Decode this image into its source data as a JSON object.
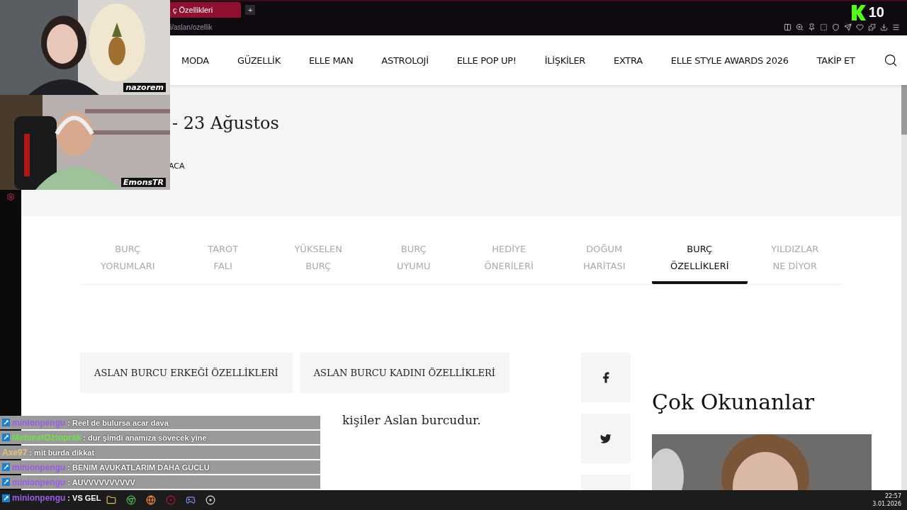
{
  "browser": {
    "tab_title": "ç Özellikleri",
    "new_tab": "+",
    "url": "i/aslan/ozellik"
  },
  "stream_overlay": {
    "viewers": "10"
  },
  "webcams": [
    {
      "kind": "picture",
      "label": "nazorem"
    },
    {
      "kind": "picture",
      "label": "EmonsTR"
    }
  ],
  "nav": {
    "items": [
      "MODA",
      "GÜZELLİK",
      "ELLE MAN",
      "ASTROLOJİ",
      "ELLE POP UP!",
      "İLİŞKİLER",
      "EXTRA",
      "ELLE STYLE AWARDS 2026",
      "TAKİP ET"
    ]
  },
  "header": {
    "date_range": "- 23 Ağustos",
    "element_partial": "ACA"
  },
  "tabs": [
    {
      "lines": [
        "BURÇ",
        "YORUMLARI"
      ],
      "selected": false
    },
    {
      "lines": [
        "TAROT",
        "FALI"
      ],
      "selected": false
    },
    {
      "lines": [
        "YÜKSELEN",
        "BURÇ"
      ],
      "selected": false
    },
    {
      "lines": [
        "BURÇ",
        "UYUMU"
      ],
      "selected": false
    },
    {
      "lines": [
        "HEDİYE",
        "ÖNERİLERİ"
      ],
      "selected": false
    },
    {
      "lines": [
        "DOĞUM",
        "HARİTASI"
      ],
      "selected": false
    },
    {
      "lines": [
        "BURÇ",
        "ÖZELLİKLERİ"
      ],
      "selected": true
    },
    {
      "lines": [
        "YILDIZLAR",
        "NE DİYOR"
      ],
      "selected": false
    }
  ],
  "gender_buttons": [
    "ASLAN BURCU ERKEĞİ ÖZELLİKLERİ",
    "ASLAN BURCU KADINI ÖZELLİKLERİ"
  ],
  "intro": "kişiler Aslan burcudur.",
  "sidebar": {
    "title": "Çok Okunanlar"
  },
  "chat": [
    {
      "user": "minionpengu",
      "color": "#9b5de5",
      "badge": true,
      "message": ": Reel de bulursa acar dava"
    },
    {
      "user": "MehmetOztoprak",
      "color": "#6ee04a",
      "badge": true,
      "message": ": dur şimdi anamıza sövecek yine"
    },
    {
      "user": "Axe97",
      "color": "#e8c07a",
      "badge": false,
      "message": ": mit burda dikkat"
    },
    {
      "user": "minionpengu",
      "color": "#9b5de5",
      "badge": true,
      "message": ": BENIM AVUKATLARIM DAHA GUCLU"
    },
    {
      "user": "minionpengu",
      "color": "#9b5de5",
      "badge": true,
      "message": ": AUVVVVVVVVVV"
    },
    {
      "user": "minionpengu",
      "color": "#9b5de5",
      "badge": true,
      "message": ": VS GEL"
    }
  ],
  "taskbar": {
    "time": "22:57",
    "date": "3.01.2026"
  }
}
